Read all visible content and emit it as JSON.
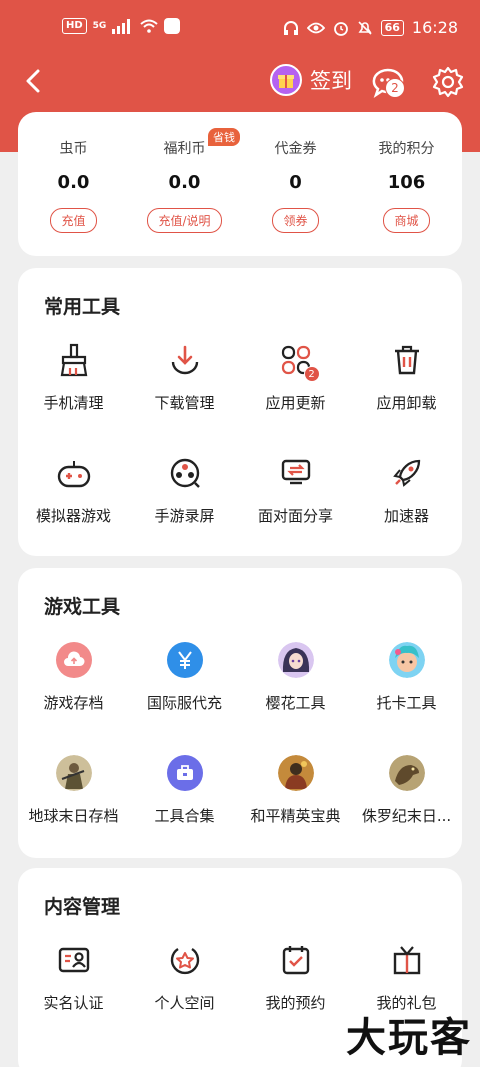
{
  "status_bar": {
    "left": [
      "HD",
      "5G"
    ],
    "time": "16:28",
    "battery": "66"
  },
  "nav": {
    "checkin_label": "签到",
    "message_badge": "2"
  },
  "wallet": {
    "items": [
      {
        "title": "虫币",
        "value": "0.0",
        "button": "充值"
      },
      {
        "title": "福利币",
        "value": "0.0",
        "button": "充值/说明",
        "tag": "省钱"
      },
      {
        "title": "代金券",
        "value": "0",
        "button": "领券"
      },
      {
        "title": "我的积分",
        "value": "106",
        "button": "商城"
      }
    ]
  },
  "common_tools": {
    "title": "常用工具",
    "items": [
      {
        "label": "手机清理",
        "icon": "broom-icon"
      },
      {
        "label": "下载管理",
        "icon": "download-icon"
      },
      {
        "label": "应用更新",
        "icon": "app-update-icon",
        "badge": "2"
      },
      {
        "label": "应用卸载",
        "icon": "trash-icon"
      },
      {
        "label": "模拟器游戏",
        "icon": "gamepad-icon"
      },
      {
        "label": "手游录屏",
        "icon": "film-reel-icon"
      },
      {
        "label": "面对面分享",
        "icon": "share-screen-icon"
      },
      {
        "label": "加速器",
        "icon": "rocket-icon"
      }
    ]
  },
  "game_tools": {
    "title": "游戏工具",
    "items": [
      {
        "label": "游戏存档",
        "icon": "cloud-upload-icon"
      },
      {
        "label": "国际服代充",
        "icon": "yen-icon"
      },
      {
        "label": "樱花工具",
        "icon": "anime-avatar-icon"
      },
      {
        "label": "托卡工具",
        "icon": "toca-avatar-icon"
      },
      {
        "label": "地球末日存档",
        "icon": "soldier-avatar-icon"
      },
      {
        "label": "工具合集",
        "icon": "toolbox-icon"
      },
      {
        "label": "和平精英宝典",
        "icon": "pubg-avatar-icon"
      },
      {
        "label": "侏罗纪末日...",
        "icon": "dino-avatar-icon"
      }
    ]
  },
  "content_mgmt": {
    "title": "内容管理",
    "items": [
      {
        "label": "实名认证",
        "icon": "id-card-icon"
      },
      {
        "label": "个人空间",
        "icon": "star-badge-icon"
      },
      {
        "label": "我的预约",
        "icon": "calendar-check-icon"
      },
      {
        "label": "我的礼包",
        "icon": "gift-box-icon"
      }
    ]
  },
  "watermark": "大玩客",
  "colors": {
    "accent": "#e05447",
    "background": "#efefef"
  }
}
